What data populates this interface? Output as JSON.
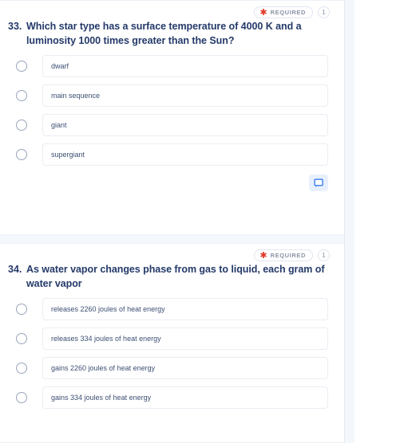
{
  "colors": {
    "page_background": "#f4f7fc",
    "card_background": "#ffffff",
    "question_text": "#243a69",
    "option_text": "#3d4f73",
    "required_asterisk": "#e0392b",
    "badge_text": "#8a93a5",
    "comment_icon": "#4285f4",
    "comment_icon_background": "#e9f0fd",
    "radio_border": "#9aa5bb",
    "option_border": "#eaedf3"
  },
  "questions": [
    {
      "number": "33.",
      "badge": {
        "asterisk": "✱",
        "required_label": "REQUIRED",
        "point_count": "1"
      },
      "text": "Which star type has a surface temperature of 4000 K and a luminosity 1000 times greater than the Sun?",
      "options": [
        {
          "label": "dwarf",
          "selected": false
        },
        {
          "label": "main sequence",
          "selected": false
        },
        {
          "label": "giant",
          "selected": false
        },
        {
          "label": "supergiant",
          "selected": false
        }
      ],
      "comment_icon": "comment-icon",
      "has_comment_button": true
    },
    {
      "number": "34.",
      "badge": {
        "asterisk": "✱",
        "required_label": "REQUIRED",
        "point_count": "1"
      },
      "text": "As water vapor changes phase from gas to liquid, each gram of water vapor",
      "options": [
        {
          "label": "releases 2260 joules of heat energy",
          "selected": false
        },
        {
          "label": "releases 334 joules of heat energy",
          "selected": false
        },
        {
          "label": "gains 2260 joules of heat energy",
          "selected": false
        },
        {
          "label": "gains 334 joules of heat energy",
          "selected": false
        }
      ],
      "has_comment_button": false
    }
  ]
}
